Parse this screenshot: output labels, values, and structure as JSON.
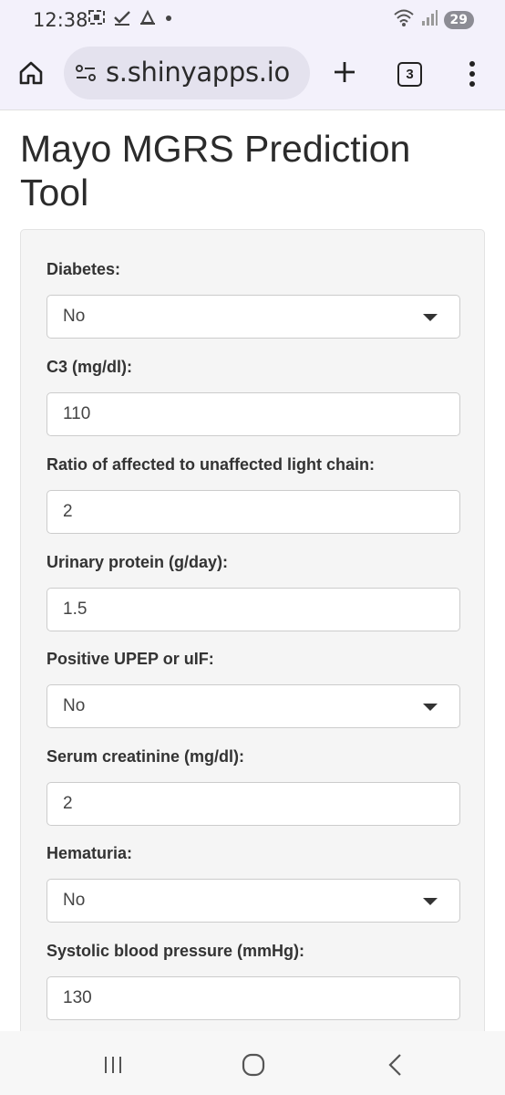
{
  "status_bar": {
    "time": "12:38",
    "battery": "29",
    "left_icons": [
      "screenshot-icon",
      "check-icon",
      "alarm-icon",
      "dot-icon"
    ],
    "right_icons": [
      "wifi-icon",
      "signal-icon"
    ]
  },
  "browser": {
    "url": "s.shinyapps.io",
    "tab_count": "3",
    "icons": [
      "home-icon",
      "site-settings-icon",
      "new-tab-plus-icon",
      "tab-switcher-icon",
      "overflow-menu-icon"
    ]
  },
  "page": {
    "title": "Mayo MGRS Prediction Tool",
    "fields": [
      {
        "label": "Diabetes:",
        "type": "select",
        "value": "No"
      },
      {
        "label": "C3 (mg/dl):",
        "type": "input",
        "value": "110"
      },
      {
        "label": "Ratio of affected to unaffected light chain:",
        "type": "input",
        "value": "2"
      },
      {
        "label": "Urinary protein (g/day):",
        "type": "input",
        "value": "1.5"
      },
      {
        "label": "Positive UPEP or uIF:",
        "type": "select",
        "value": "No"
      },
      {
        "label": "Serum creatinine (mg/dl):",
        "type": "input",
        "value": "2"
      },
      {
        "label": "Hematuria:",
        "type": "select",
        "value": "No"
      },
      {
        "label": "Systolic blood pressure (mmHg):",
        "type": "input",
        "value": "130"
      }
    ]
  },
  "nav_bar": {
    "icons": [
      "recent-apps-icon",
      "home-circle-icon",
      "back-icon"
    ]
  },
  "colors": {
    "chrome_bg": "#f3f1fb",
    "url_pill": "#e4e2ee",
    "well_bg": "#f5f5f5",
    "input_border": "#cccccc"
  }
}
